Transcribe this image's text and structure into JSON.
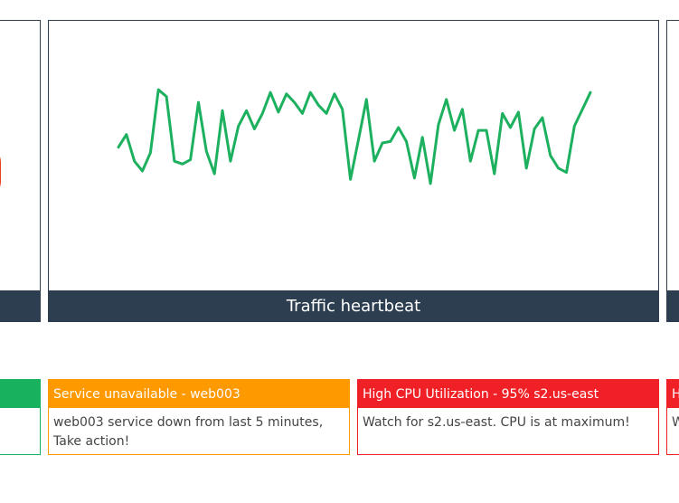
{
  "panels": {
    "heartbeat": {
      "title": "Traffic heartbeat",
      "line_color": "#1db15f"
    }
  },
  "chart_data": {
    "type": "line",
    "title": "Traffic heartbeat",
    "x": [
      0,
      1,
      2,
      3,
      4,
      5,
      6,
      7,
      8,
      9,
      10,
      11,
      12,
      13,
      14,
      15,
      16,
      17,
      18,
      19,
      20,
      21,
      22,
      23,
      24,
      25,
      26,
      27,
      28,
      29,
      30,
      31,
      32,
      33,
      34,
      35,
      36,
      37,
      38,
      39,
      40,
      41,
      42,
      43,
      44,
      45,
      46,
      47,
      48,
      49,
      50,
      51,
      52,
      53,
      54,
      55,
      56,
      57,
      58,
      59
    ],
    "series": [
      {
        "values": [
          57,
          66,
          47,
          40,
          53,
          98,
          93,
          47,
          45,
          48,
          89,
          54,
          38,
          83,
          47,
          72,
          83,
          70,
          81,
          96,
          82,
          95,
          89,
          81,
          96,
          87,
          81,
          95,
          84,
          34,
          62,
          91,
          47,
          60,
          61,
          71,
          61,
          35,
          64,
          31,
          73,
          91,
          69,
          84,
          47,
          69,
          69,
          38,
          81,
          71,
          82,
          42,
          70,
          78,
          51,
          42,
          39,
          72,
          84,
          96
        ]
      }
    ],
    "ylim": [
      0,
      100
    ]
  },
  "alerts": [
    {
      "head": "",
      "body": "",
      "color": "#18b25e"
    },
    {
      "head": "Service unavailable - web003",
      "body": "web003 service down from last 5 minutes, Take action!",
      "color": "#ff9900"
    },
    {
      "head": "High CPU Utilization - 95% s2.us-east",
      "body": "Watch for s2.us-east. CPU is at maximum!",
      "color": "#ef2127"
    },
    {
      "head": "H",
      "body": "W n",
      "color": "#ef2127"
    }
  ]
}
